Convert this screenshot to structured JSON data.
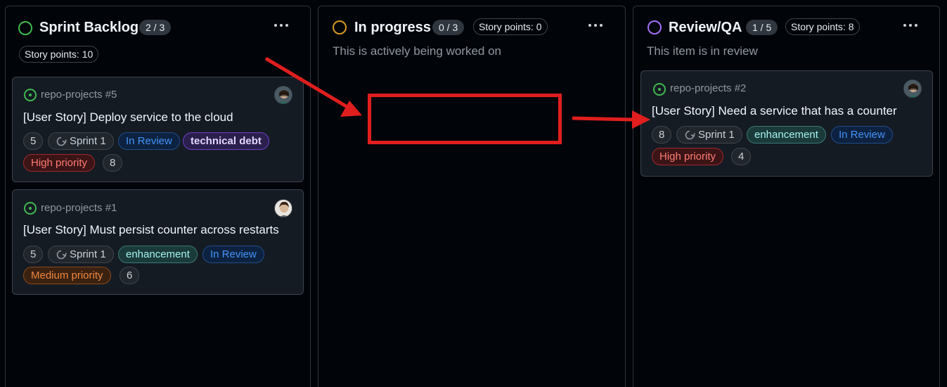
{
  "columns": [
    {
      "title": "Sprint Backlog",
      "count": "2 / 3",
      "story_points": "Story points: 10",
      "status_color": "#3fb950",
      "cards": [
        {
          "repo": "repo-projects #5",
          "title": "[User Story] Deploy service to the cloud",
          "tags": [
            "5",
            "Sprint 1",
            "In Review",
            "technical debt",
            "High priority",
            "8"
          ]
        },
        {
          "repo": "repo-projects #1",
          "title": "[User Story] Must persist counter across restarts",
          "tags": [
            "5",
            "Sprint 1",
            "enhancement",
            "In Review",
            "Medium priority",
            "6"
          ]
        }
      ]
    },
    {
      "title": "In progress",
      "count": "0 / 3",
      "story_points": "Story points: 0",
      "description": "This is actively being worked on",
      "status_color": "#d29922",
      "cards": []
    },
    {
      "title": "Review/QA",
      "count": "1 / 5",
      "story_points": "Story points: 8",
      "description": "This item is in review",
      "status_color": "#a371f7",
      "cards": [
        {
          "repo": "repo-projects #2",
          "title": "[User Story] Need a service that has a counter",
          "tags": [
            "8",
            "Sprint 1",
            "enhancement",
            "In Review",
            "High priority",
            "4"
          ]
        }
      ]
    }
  ],
  "icons": {
    "column_menu": "kebab-horizontal-icon",
    "issue": "issue-opened-icon",
    "sprint": "iteration-icon"
  },
  "annotation": {
    "color": "#e01e1e"
  }
}
